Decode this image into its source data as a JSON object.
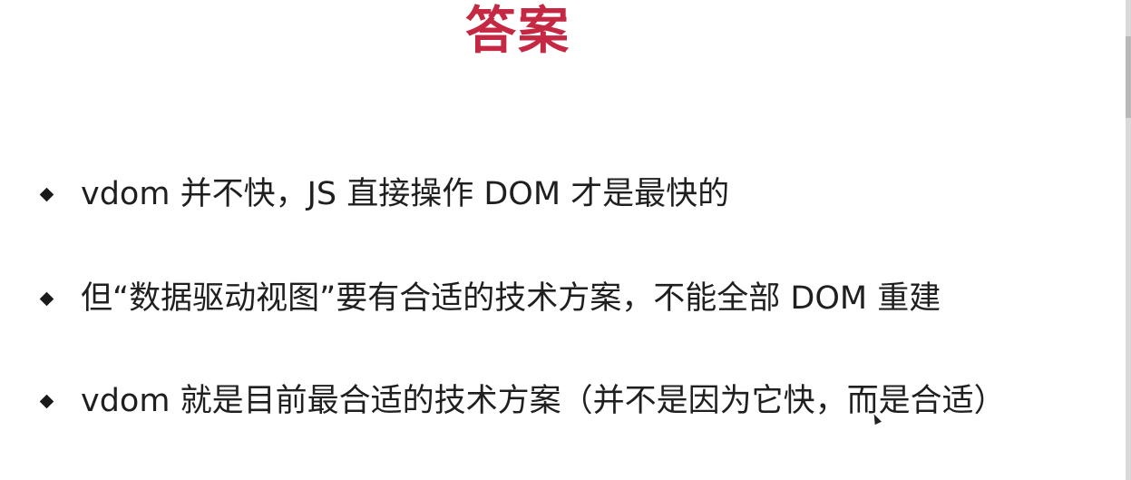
{
  "slide": {
    "title": "答案",
    "title_color": "#c42843",
    "bullets": [
      {
        "text": "vdom 并不快，JS 直接操作 DOM 才是最快的"
      },
      {
        "text": "但“数据驱动视图”要有合适的技术方案，不能全部 DOM 重建"
      },
      {
        "text": "vdom 就是目前最合适的技术方案（并不是因为它快，而是合适）"
      }
    ],
    "bullet_icon": "diamond-bullet-icon"
  },
  "cursor_icon": "mouse-pointer-icon"
}
